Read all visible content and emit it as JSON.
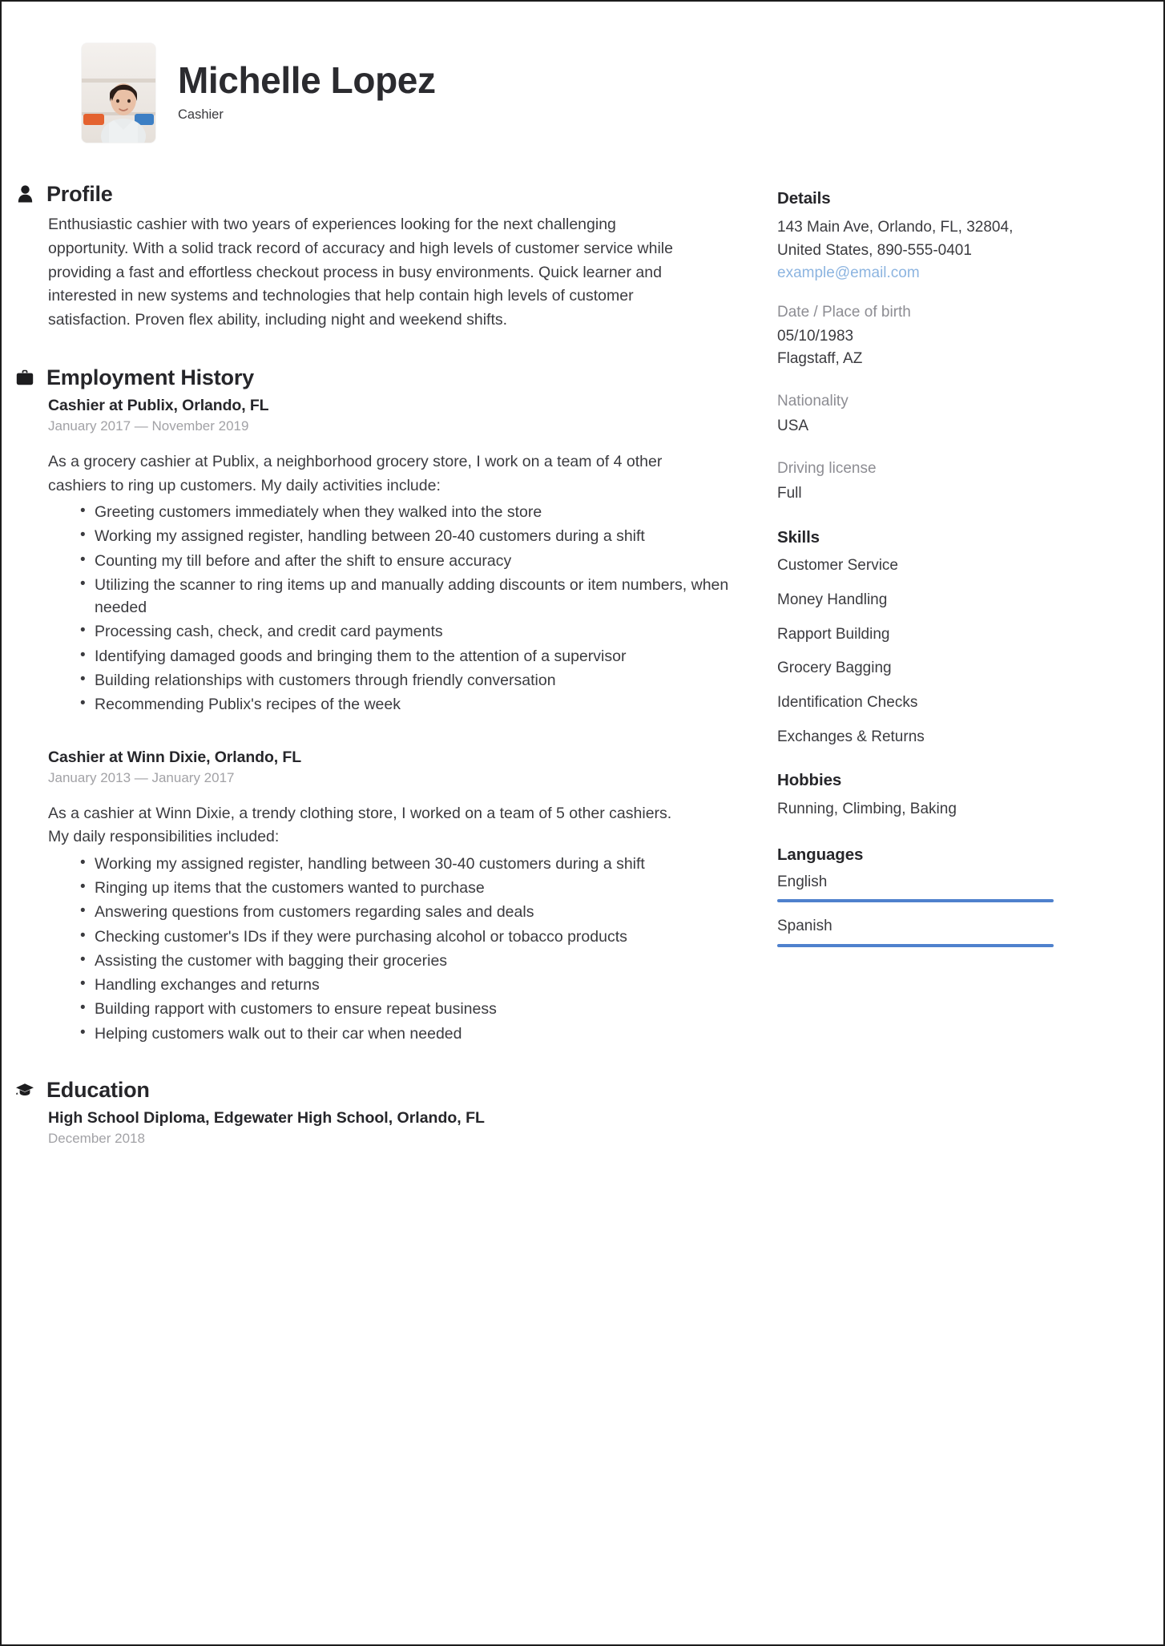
{
  "header": {
    "full_name": "Michelle Lopez",
    "job_title": "Cashier",
    "avatar_icon": "profile-photo"
  },
  "sections": {
    "profile": {
      "title": "Profile",
      "icon": "person-icon",
      "text": "Enthusiastic cashier with two years of experiences looking for the next challenging opportunity. With a solid track record of accuracy and high levels of customer service while providing a fast and effortless checkout process in busy environments. Quick learner and interested in new systems and technologies that help contain high levels of customer satisfaction. Proven flex ability, including night and weekend shifts."
    },
    "employment": {
      "title": "Employment History",
      "icon": "briefcase-icon",
      "jobs": [
        {
          "heading": "Cashier at  Publix, Orlando, FL",
          "dates": "January 2017 — November 2019",
          "intro": "As a grocery cashier at Publix, a neighborhood grocery store, I work on a team of 4 other cashiers to ring up customers. My daily activities include:",
          "bullets": [
            "Greeting customers immediately when they walked into the store",
            "Working my assigned register, handling between 20-40 customers during a shift",
            "Counting my till before and after the shift to ensure accuracy",
            "Utilizing the scanner to ring items up and manually adding discounts or item numbers, when needed",
            "Processing cash, check, and credit card payments",
            "Identifying damaged goods and bringing them to the attention of a supervisor",
            "Building relationships with customers through friendly conversation",
            "Recommending Publix's recipes of the week"
          ]
        },
        {
          "heading": "Cashier at  Winn Dixie, Orlando, FL",
          "dates": "January 2013 — January 2017",
          "intro": "As a cashier at Winn Dixie, a trendy clothing store, I worked on a team of 5 other cashiers. My daily responsibilities included:",
          "bullets": [
            "Working my assigned register, handling between 30-40 customers during a shift",
            "Ringing up items that the customers wanted to purchase",
            "Answering questions from customers regarding sales and deals",
            "Checking customer's IDs if they were purchasing alcohol or tobacco products",
            "Assisting the customer with bagging their groceries",
            "Handling exchanges and returns",
            "Building rapport with customers to ensure repeat business",
            "Helping customers walk out to their car when needed"
          ]
        }
      ]
    },
    "education": {
      "title": "Education",
      "icon": "graduation-cap-icon",
      "entries": [
        {
          "heading": "High School Diploma, Edgewater High School, Orlando, FL",
          "dates": "December 2018"
        }
      ]
    }
  },
  "sidebar": {
    "details": {
      "title": "Details",
      "address_line1": "143 Main Ave, Orlando, FL, 32804,",
      "address_line2": "United States, 890-555-0401",
      "email": "example@email.com",
      "birth_label": "Date / Place of birth",
      "birth_date": "05/10/1983",
      "birth_place": "Flagstaff, AZ",
      "nationality_label": "Nationality",
      "nationality_value": "USA",
      "license_label": "Driving license",
      "license_value": "Full"
    },
    "skills": {
      "title": "Skills",
      "items": [
        "Customer Service",
        "Money Handling",
        "Rapport Building",
        "Grocery Bagging",
        "Identification Checks",
        "Exchanges & Returns"
      ]
    },
    "hobbies": {
      "title": "Hobbies",
      "text": "Running, Climbing,  Baking"
    },
    "languages": {
      "title": "Languages",
      "items": [
        {
          "name": "English"
        },
        {
          "name": "Spanish"
        }
      ]
    }
  },
  "colors": {
    "accent_blue": "#4f81cd",
    "link_blue": "#8cb4e0",
    "text_dark": "#3b3b3f",
    "heading_dark": "#26262a",
    "muted_gray": "#a2a2a6"
  }
}
